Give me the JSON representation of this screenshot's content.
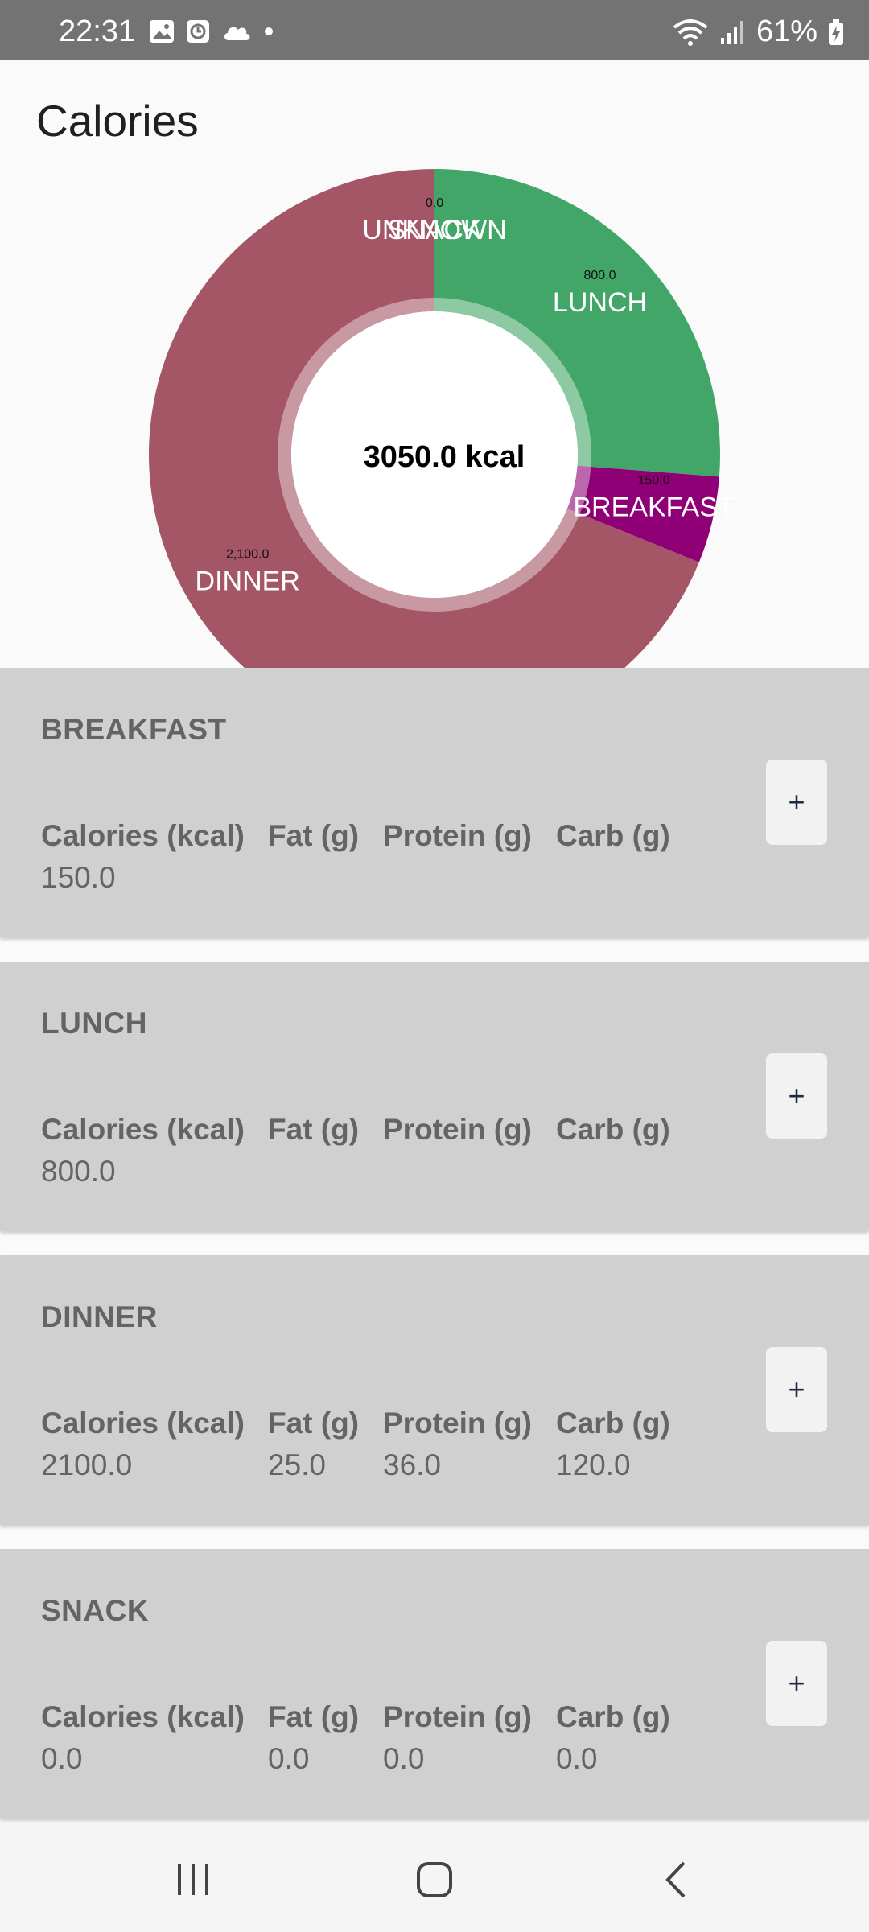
{
  "status_bar": {
    "time": "22:31",
    "battery": "61%",
    "left_icons": [
      "gallery-icon",
      "alarm-icon",
      "cloud-icon",
      "dot-icon"
    ],
    "right_icons": [
      "wifi-icon",
      "signal-icon",
      "battery-charging-icon"
    ]
  },
  "page": {
    "title": "Calories"
  },
  "chart": {
    "center_label": "3050.0 kcal",
    "colors": {
      "dinner": "#a45566",
      "lunch": "#41a667",
      "breakfast": "#8f0077"
    }
  },
  "chart_data": {
    "type": "pie",
    "donut": true,
    "center_text": "3050.0 kcal",
    "slices": [
      {
        "label": "LUNCH",
        "value": 800.0,
        "value_text": "800.0",
        "color": "#41a667"
      },
      {
        "label": "BREAKFAST",
        "value": 150.0,
        "value_text": "150.0",
        "color": "#8f0077"
      },
      {
        "label": "DINNER",
        "value": 2100.0,
        "value_text": "2,100.0",
        "color": "#a45566"
      },
      {
        "label": "SNACK",
        "value": 0.0,
        "value_text": "0.0",
        "color": "#41a667"
      },
      {
        "label": "UNKNOWN",
        "value": 0.0,
        "value_text": "",
        "color": "#41a667"
      }
    ]
  },
  "headers": {
    "calories": "Calories (kcal)",
    "fat": "Fat (g)",
    "protein": "Protein (g)",
    "carb": "Carb (g)"
  },
  "meals": [
    {
      "name": "BREAKFAST",
      "calories": "150.0",
      "fat": "",
      "protein": "",
      "carb": "",
      "add_label": "+"
    },
    {
      "name": "LUNCH",
      "calories": "800.0",
      "fat": "",
      "protein": "",
      "carb": "",
      "add_label": "+"
    },
    {
      "name": "DINNER",
      "calories": "2100.0",
      "fat": "25.0",
      "protein": "36.0",
      "carb": "120.0",
      "add_label": "+"
    },
    {
      "name": "SNACK",
      "calories": "0.0",
      "fat": "0.0",
      "protein": "0.0",
      "carb": "0.0",
      "add_label": "+"
    }
  ]
}
